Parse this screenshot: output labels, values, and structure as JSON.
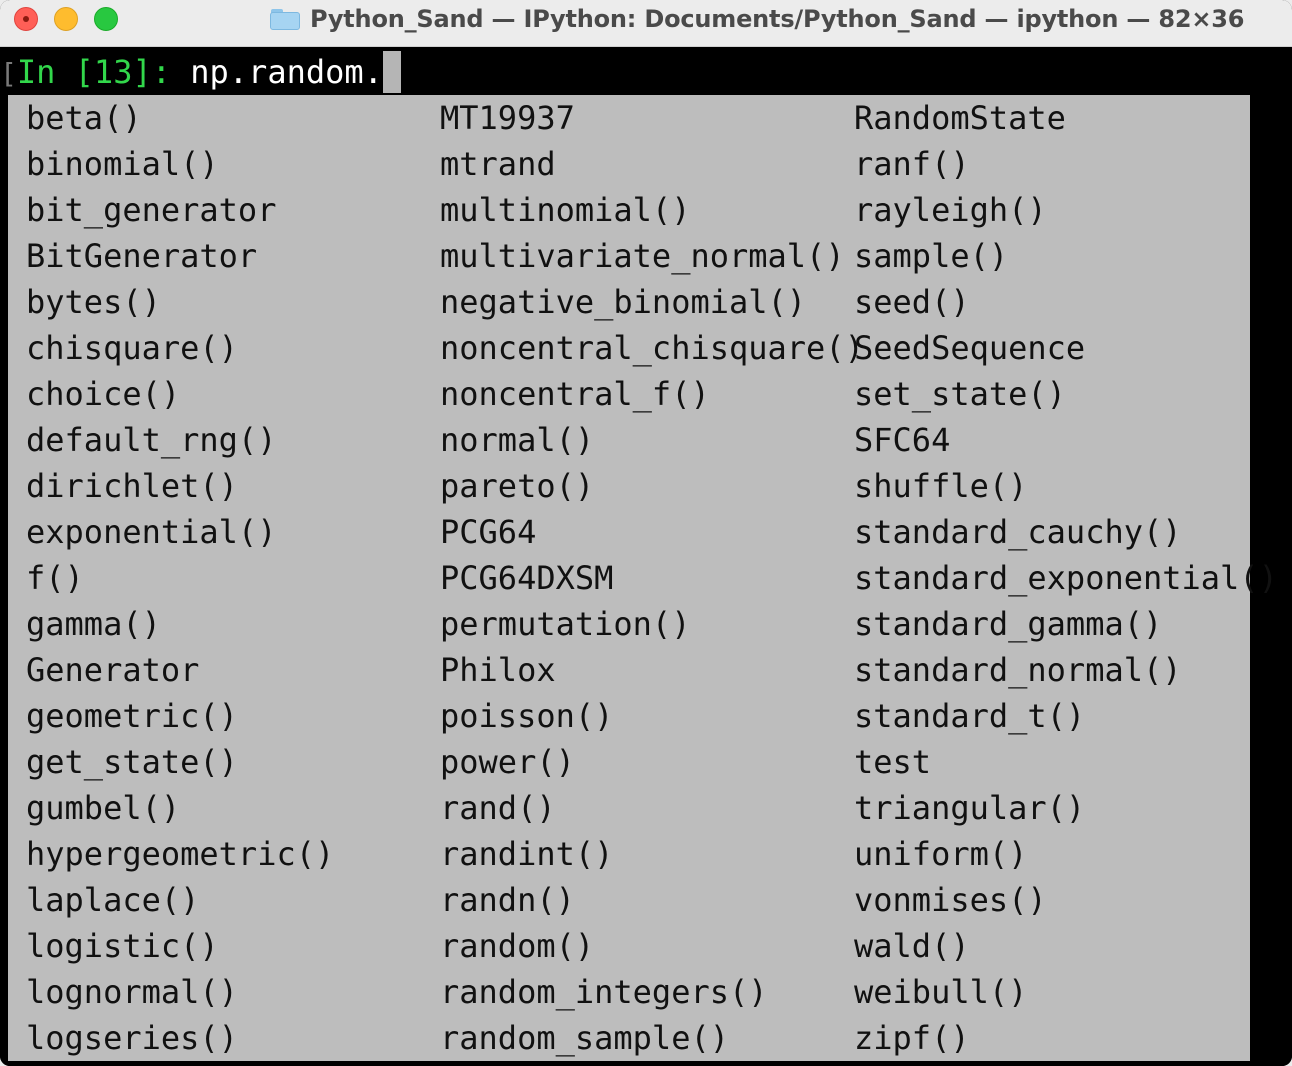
{
  "window": {
    "title": "Python_Sand — IPython: Documents/Python_Sand — ipython — 82×36"
  },
  "prompt": {
    "bracket": "[",
    "in_label": "In ",
    "number": "[13]: ",
    "input": "np.random."
  },
  "completions": {
    "col1": [
      "beta()",
      "binomial()",
      "bit_generator",
      "BitGenerator",
      "bytes()",
      "chisquare()",
      "choice()",
      "default_rng()",
      "dirichlet()",
      "exponential()",
      "f()",
      "gamma()",
      "Generator",
      "geometric()",
      "get_state()",
      "gumbel()",
      "hypergeometric()",
      "laplace()",
      "logistic()",
      "lognormal()",
      "logseries()"
    ],
    "col2": [
      "MT19937",
      "mtrand",
      "multinomial()",
      "multivariate_normal()",
      "negative_binomial()",
      "noncentral_chisquare()",
      "noncentral_f()",
      "normal()",
      "pareto()",
      "PCG64",
      "PCG64DXSM",
      "permutation()",
      "Philox",
      "poisson()",
      "power()",
      "rand()",
      "randint()",
      "randn()",
      "random()",
      "random_integers()",
      "random_sample()"
    ],
    "col3": [
      "RandomState",
      "ranf()",
      "rayleigh()",
      "sample()",
      "seed()",
      "SeedSequence",
      "set_state()",
      "SFC64",
      "shuffle()",
      "standard_cauchy()",
      "standard_exponential()",
      "standard_gamma()",
      "standard_normal()",
      "standard_t()",
      "test",
      "triangular()",
      "uniform()",
      "vonmises()",
      "wald()",
      "weibull()",
      "zipf()"
    ]
  },
  "colors": {
    "titlebar": "#ececec",
    "terminal_bg": "#000000",
    "prompt_green": "#32d74b",
    "completion_bg": "#bdbdbd",
    "completion_text": "#111111"
  },
  "icons": {
    "title_icon": "folder-icon"
  }
}
